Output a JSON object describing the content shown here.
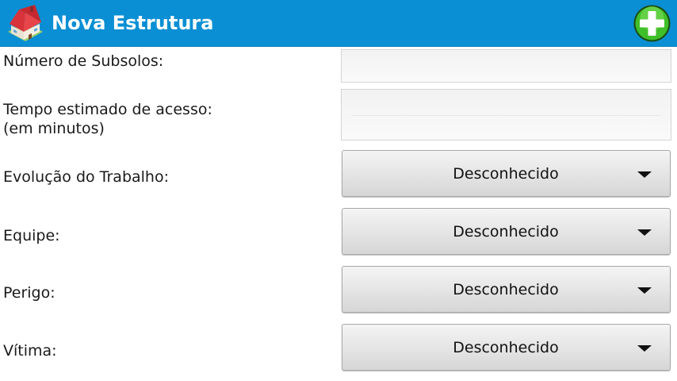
{
  "titlebar": {
    "title": "Nova Estrutura",
    "icon": "house-icon",
    "add_icon": "plus-circle-icon"
  },
  "colors": {
    "titlebar_bg": "#0a8fd4",
    "add_button_green": "#2db82d"
  },
  "form": {
    "subsolos": {
      "label": "Número de Subsolos:",
      "value": ""
    },
    "tempo": {
      "label": "Tempo estimado de acesso:\n(em minutos)",
      "value": ""
    },
    "evolucao": {
      "label": "Evolução do Trabalho:",
      "value": "Desconhecido"
    },
    "equipe": {
      "label": "Equipe:",
      "value": "Desconhecido"
    },
    "perigo": {
      "label": "Perigo:",
      "value": "Desconhecido"
    },
    "vitima": {
      "label": "Vítima:",
      "value": "Desconhecido"
    }
  }
}
